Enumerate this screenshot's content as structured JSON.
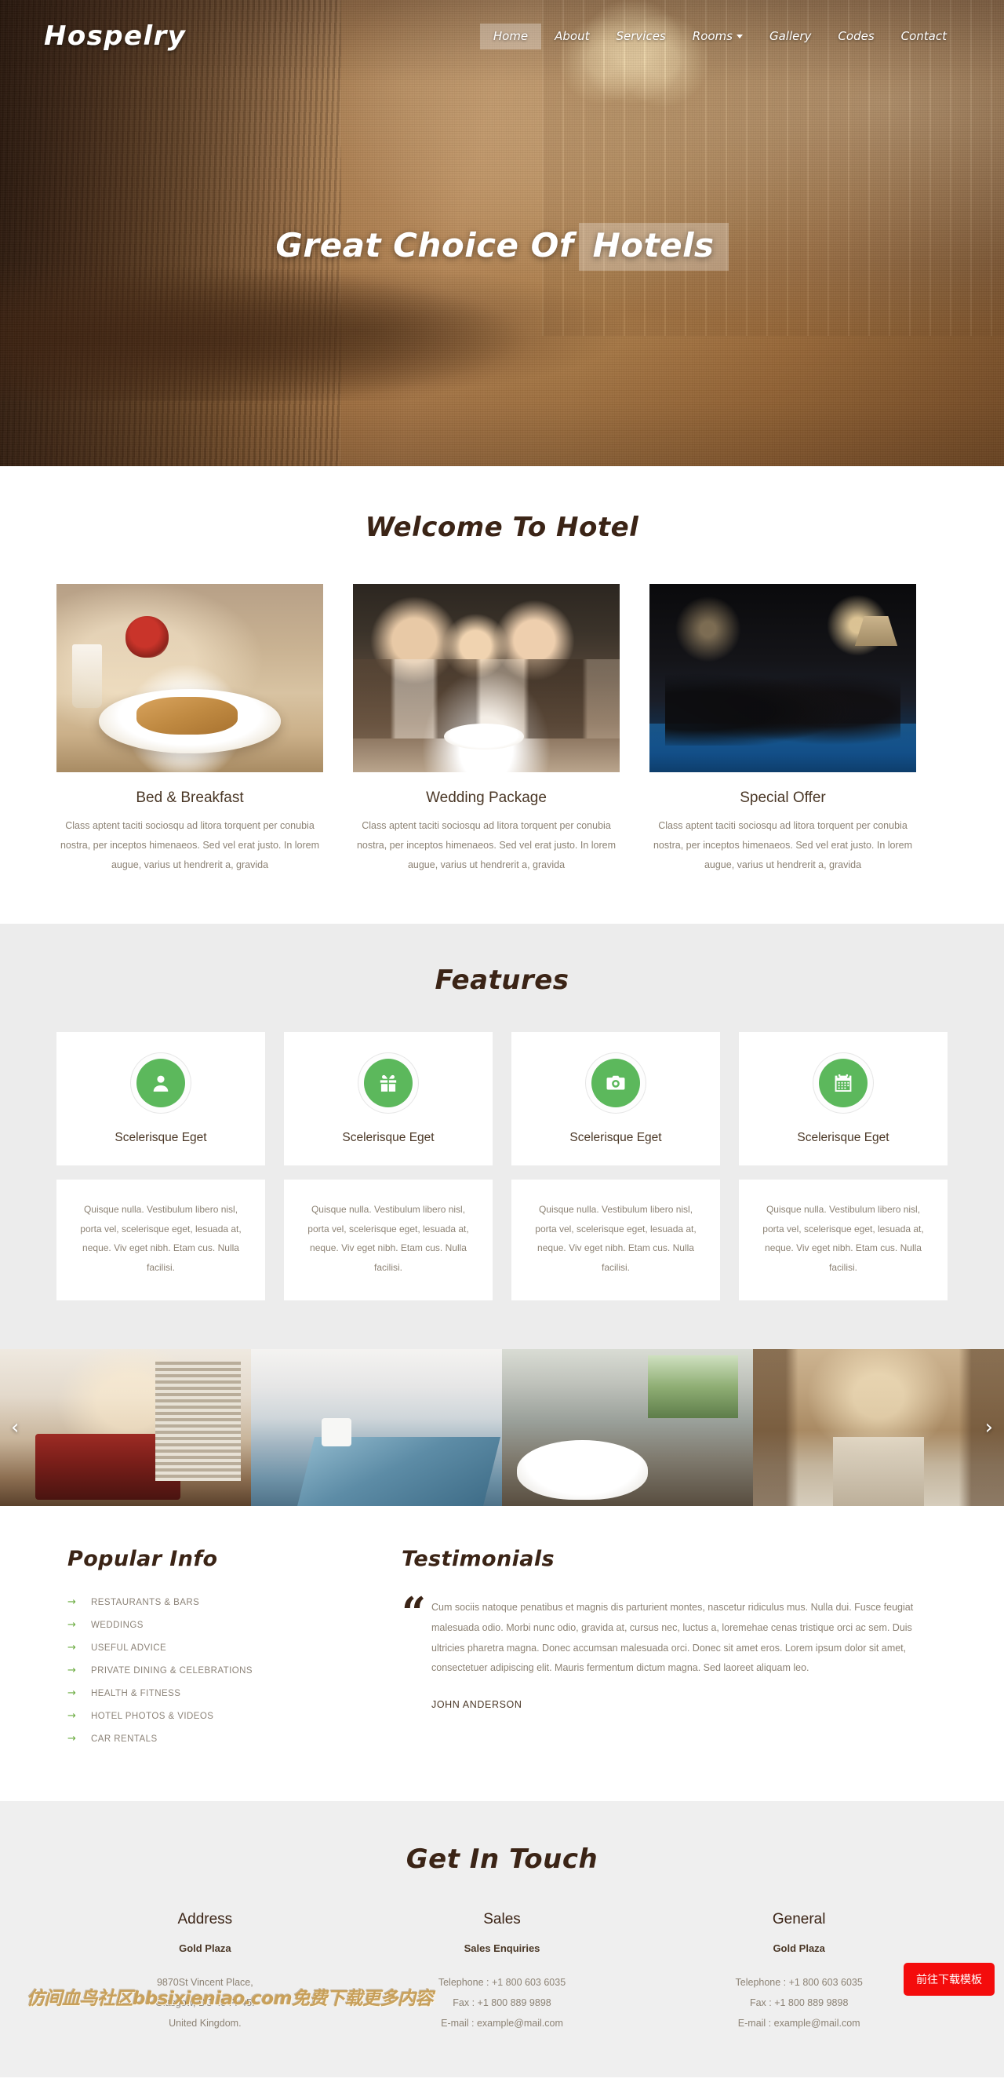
{
  "brand": "Hospelry",
  "nav": {
    "items": [
      {
        "label": "Home",
        "active": true,
        "caret": false
      },
      {
        "label": "About",
        "active": false,
        "caret": false
      },
      {
        "label": "Services",
        "active": false,
        "caret": false
      },
      {
        "label": "Rooms",
        "active": false,
        "caret": true
      },
      {
        "label": "Gallery",
        "active": false,
        "caret": false
      },
      {
        "label": "Codes",
        "active": false,
        "caret": false
      },
      {
        "label": "Contact",
        "active": false,
        "caret": false
      }
    ]
  },
  "hero": {
    "title_plain": "Great Choice Of",
    "title_highlight": "Hotels"
  },
  "welcome": {
    "title": "Welcome To Hotel",
    "cards": [
      {
        "title": "Bed & Breakfast",
        "text": "Class aptent taciti sociosqu ad litora torquent per conubia nostra, per inceptos himenaeos. Sed vel erat justo. In lorem augue, varius ut hendrerit a, gravida"
      },
      {
        "title": "Wedding Package",
        "text": "Class aptent taciti sociosqu ad litora torquent per conubia nostra, per inceptos himenaeos. Sed vel erat justo. In lorem augue, varius ut hendrerit a, gravida"
      },
      {
        "title": "Special Offer",
        "text": "Class aptent taciti sociosqu ad litora torquent per conubia nostra, per inceptos himenaeos. Sed vel erat justo. In lorem augue, varius ut hendrerit a, gravida"
      }
    ]
  },
  "features": {
    "title": "Features",
    "accent_color": "#5cb85c",
    "items": [
      {
        "icon": "user-icon",
        "name": "Scelerisque Eget",
        "text": "Quisque nulla. Vestibulum libero nisl, porta vel, scelerisque eget, lesuada at, neque. Viv eget nibh. Etam cus. Nulla facilisi."
      },
      {
        "icon": "gift-icon",
        "name": "Scelerisque Eget",
        "text": "Quisque nulla. Vestibulum libero nisl, porta vel, scelerisque eget, lesuada at, neque. Viv eget nibh. Etam cus. Nulla facilisi."
      },
      {
        "icon": "camera-icon",
        "name": "Scelerisque Eget",
        "text": "Quisque nulla. Vestibulum libero nisl, porta vel, scelerisque eget, lesuada at, neque. Viv eget nibh. Etam cus. Nulla facilisi."
      },
      {
        "icon": "calendar-icon",
        "name": "Scelerisque Eget",
        "text": "Quisque nulla. Vestibulum libero nisl, porta vel, scelerisque eget, lesuada at, neque. Viv eget nibh. Etam cus. Nulla facilisi."
      }
    ]
  },
  "gallery": {
    "prev_label": "‹",
    "next_label": "›",
    "slides": [
      {
        "alt": "hotel-bedroom"
      },
      {
        "alt": "indoor-swimming-pool"
      },
      {
        "alt": "bathroom"
      },
      {
        "alt": "grand-hallway"
      }
    ]
  },
  "popular_info": {
    "title": "Popular Info",
    "arrow": "→",
    "links": [
      "RESTAURANTS & BARS",
      "WEDDINGS",
      "USEFUL ADVICE",
      "PRIVATE DINING & CELEBRATIONS",
      "HEALTH & FITNESS",
      "HOTEL PHOTOS & VIDEOS",
      "CAR RENTALS"
    ]
  },
  "testimonials": {
    "title": "Testimonials",
    "quote_mark": "“",
    "text": "Cum sociis natoque penatibus et magnis dis parturient montes, nascetur ridiculus mus. Nulla dui. Fusce feugiat malesuada odio. Morbi nunc odio, gravida at, cursus nec, luctus a, loremehae cenas tristique orci ac sem. Duis ultricies pharetra magna. Donec accumsan malesuada orci. Donec sit amet eros. Lorem ipsum dolor sit amet, consectetuer adipiscing elit. Mauris fermentum dictum magna. Sed laoreet aliquam leo.",
    "author": "JOHN ANDERSON"
  },
  "get_in_touch": {
    "title": "Get In Touch",
    "columns": [
      {
        "heading": "Address",
        "subheading": "Gold Plaza",
        "lines": [
          "9870St Vincent Place,",
          "Glasgow, DC 45 Fr 45.",
          "United Kingdom."
        ]
      },
      {
        "heading": "Sales",
        "subheading": "Sales Enquiries",
        "lines": [
          "Telephone : +1 800 603 6035",
          "Fax : +1 800 889 9898",
          "E-mail : example@mail.com"
        ]
      },
      {
        "heading": "General",
        "subheading": "Gold Plaza",
        "lines": [
          "Telephone : +1 800 603 6035",
          "Fax : +1 800 889 9898",
          "E-mail : example@mail.com"
        ]
      }
    ]
  },
  "overlay": {
    "watermark": "仿间血鸟社区bbsixieniao.com免费下载更多内容",
    "download_button": "前往下载模板",
    "download_button_color": "#f40c0c"
  }
}
